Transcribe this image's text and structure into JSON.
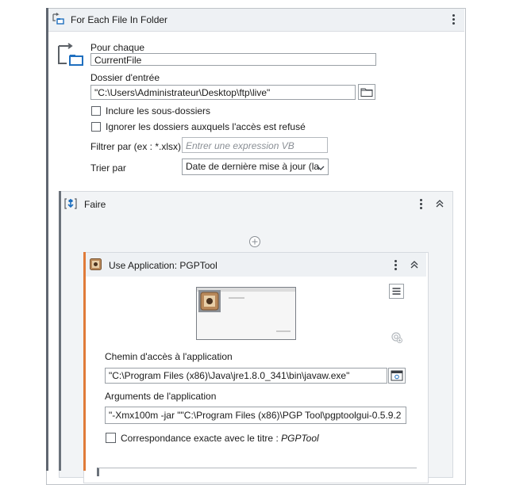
{
  "for_each": {
    "title": "For Each File In Folder",
    "for_each_label": "Pour chaque",
    "for_each_value": "CurrentFile",
    "input_folder_label": "Dossier d'entrée",
    "input_folder_value": "\"C:\\Users\\Administrateur\\Desktop\\ftp\\live\"",
    "include_subfolders_label": "Inclure les sous-dossiers",
    "ignore_denied_label": "Ignorer les dossiers auxquels l'accès est refusé",
    "filter_label": "Filtrer par (ex : *.xlsx)",
    "filter_placeholder": "Entrer une expression VB",
    "sort_label": "Trier par",
    "sort_value": "Date de dernière mise à jour (la"
  },
  "do_block": {
    "title": "Faire"
  },
  "use_app": {
    "title": "Use Application: PGPTool",
    "app_path_label": "Chemin d'accès à l'application",
    "app_path_value": "\"C:\\Program Files (x86)\\Java\\jre1.8.0_341\\bin\\javaw.exe\"",
    "app_args_label": "Arguments de l'application",
    "app_args_value": "\"-Xmx100m -jar \"\"C:\\Program Files (x86)\\PGP Tool\\pgptoolgui-0.5.9.2",
    "exact_title_label": "Correspondance exacte avec le titre : ",
    "exact_title_value": "PGPTool"
  },
  "colors": {
    "accent_orange": "#e07b39",
    "header_bg": "#eef1f4",
    "icon_blue": "#1f6fbf"
  }
}
